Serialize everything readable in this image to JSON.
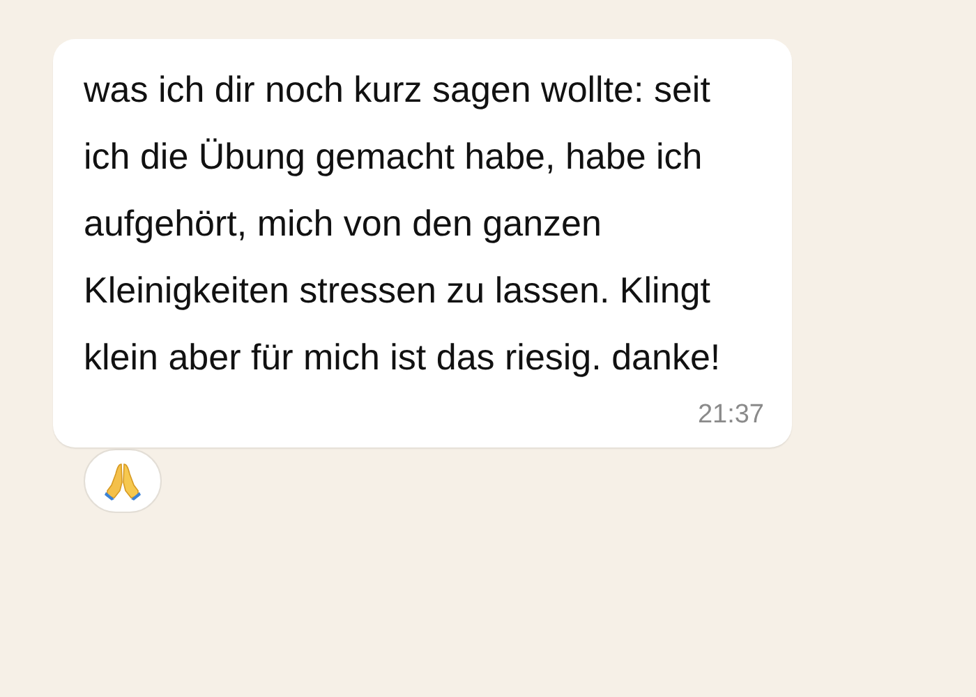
{
  "message": {
    "text": "was ich dir noch kurz sagen wollte: seit ich die Übung gemacht habe, habe ich aufgehört, mich von den ganzen Kleinigkeiten stressen zu lassen. Klingt klein aber für mich ist das riesig. danke!",
    "time": "21:37"
  },
  "reactions": [
    {
      "kind": "praying_hands"
    }
  ]
}
